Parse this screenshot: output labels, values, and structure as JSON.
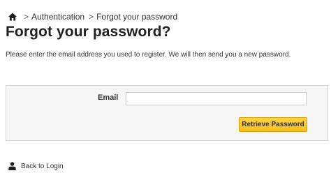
{
  "breadcrumb": {
    "home_icon": "home-icon",
    "separator": ">",
    "items": [
      {
        "label": "Authentication"
      },
      {
        "label": "Forgot your password"
      }
    ]
  },
  "page": {
    "title": "Forgot your password?",
    "intro": "Please enter the email address you used to register. We will then send you a new password."
  },
  "form": {
    "email_label": "Email",
    "email_value": "",
    "email_placeholder": "",
    "submit_label": "Retrieve Password"
  },
  "footer": {
    "back_icon": "user-icon",
    "back_label": "Back to Login"
  },
  "colors": {
    "button_bg": "#fdc929",
    "button_border": "#d8a200",
    "form_bg": "#f6f6f6",
    "form_border": "#d6d4d4"
  }
}
